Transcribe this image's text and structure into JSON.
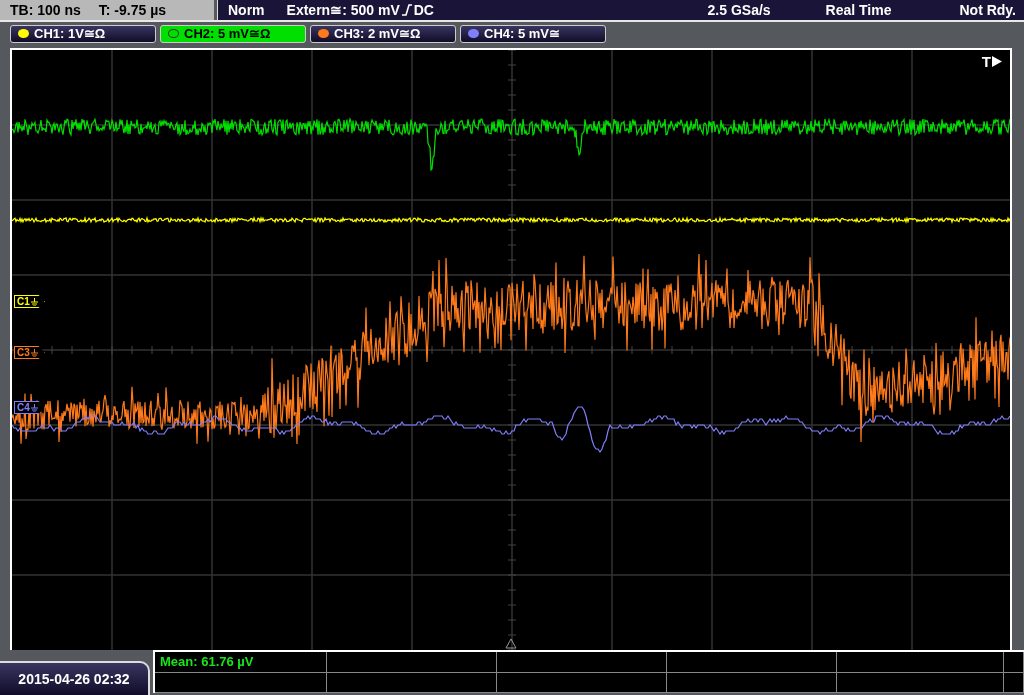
{
  "timebase": {
    "tb": "TB: 100 ns",
    "t": "T: -9.75 µs"
  },
  "trigger_bar": {
    "mode": "Norm",
    "source": "Extern≅: 500 mV",
    "coupling": "DC",
    "sample_rate": "2.5 GSa/s",
    "acquisition": "Real Time",
    "status": "Not Rdy."
  },
  "channels": [
    {
      "label": "CH1: 1V≅Ω",
      "color": "#ffff00",
      "selected": false
    },
    {
      "label": "CH2: 5 mV≅Ω",
      "color": "#00e000",
      "selected": true
    },
    {
      "label": "CH3: 2 mV≅Ω",
      "color": "#ff7a1a",
      "selected": false
    },
    {
      "label": "CH4: 5 mV≅",
      "color": "#8080ff",
      "selected": false
    }
  ],
  "markers": [
    {
      "label": "C1",
      "color": "#ffff00"
    },
    {
      "label": "C3",
      "color": "#ff7a1a"
    },
    {
      "label": "C4",
      "color": "#8080ff"
    }
  ],
  "trigger_marker": "T",
  "measurements": [
    {
      "text": "Mean: 61.76 µV"
    }
  ],
  "date": "2015-04-26 02:32"
}
